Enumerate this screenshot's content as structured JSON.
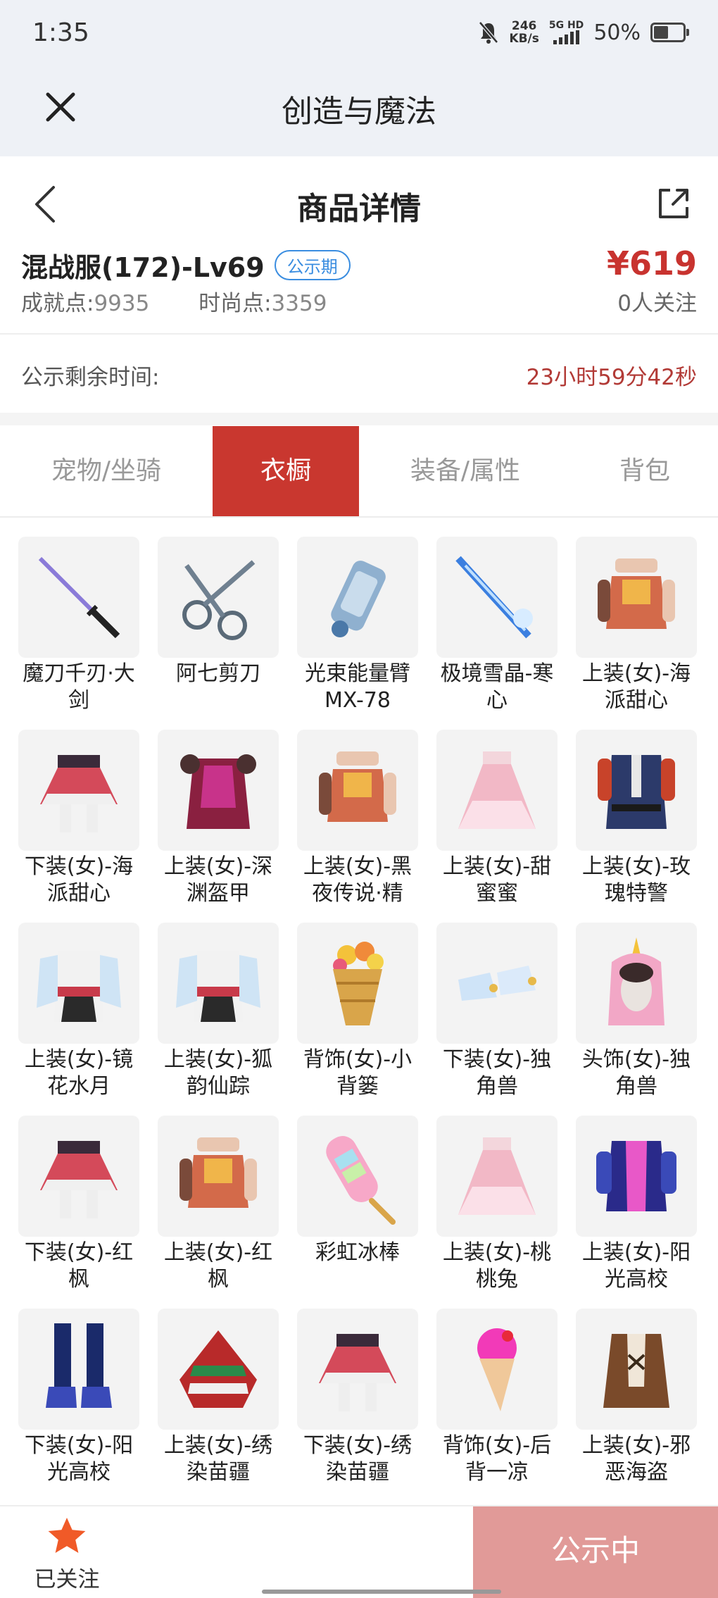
{
  "status_bar": {
    "time": "1:35",
    "speed_value": "246",
    "speed_unit": "KB/s",
    "network": "5G HD",
    "battery": "50%",
    "battery_level": 0.5
  },
  "app_bar": {
    "title": "创造与魔法"
  },
  "nav": {
    "title": "商品详情"
  },
  "item": {
    "name": "混战服(172)-Lv69",
    "badge": "公示期",
    "achievement_label": "成就点:",
    "achievement_value": "9935",
    "fashion_label": "时尚点:",
    "fashion_value": "3359",
    "price": "¥619",
    "followers": "0人关注"
  },
  "countdown": {
    "label": "公示剩余时间:",
    "value": "23小时59分42秒"
  },
  "tabs": [
    {
      "label": "宠物/坐骑",
      "active": false
    },
    {
      "label": "衣橱",
      "active": true
    },
    {
      "label": "装备/属性",
      "active": false
    },
    {
      "label": "背包",
      "active": false
    }
  ],
  "wardrobe": [
    {
      "label": "魔刀千刃·大剑",
      "icon": "sword-icon"
    },
    {
      "label": "阿七剪刀",
      "icon": "scissors-icon"
    },
    {
      "label": "光束能量臂MX-78",
      "icon": "arm-cannon-icon"
    },
    {
      "label": "极境雪晶-寒心",
      "icon": "ice-sword-icon"
    },
    {
      "label": "上装(女)-海派甜心",
      "icon": "top-outfit-icon"
    },
    {
      "label": "下装(女)-海派甜心",
      "icon": "skirt-icon"
    },
    {
      "label": "上装(女)-深渊盔甲",
      "icon": "armor-icon"
    },
    {
      "label": "上装(女)-黑夜传说·精",
      "icon": "top-outfit-icon"
    },
    {
      "label": "上装(女)-甜蜜蜜",
      "icon": "dress-icon"
    },
    {
      "label": "上装(女)-玫瑰特警",
      "icon": "uniform-icon"
    },
    {
      "label": "上装(女)-镜花水月",
      "icon": "kimono-icon"
    },
    {
      "label": "上装(女)-狐韵仙踪",
      "icon": "kimono-icon"
    },
    {
      "label": "背饰(女)-小背篓",
      "icon": "basket-icon"
    },
    {
      "label": "下装(女)-独角兽",
      "icon": "shoes-icon"
    },
    {
      "label": "头饰(女)-独角兽",
      "icon": "unicorn-hood-icon"
    },
    {
      "label": "下装(女)-红枫",
      "icon": "skirt-icon"
    },
    {
      "label": "上装(女)-红枫",
      "icon": "top-outfit-icon"
    },
    {
      "label": "彩虹冰棒",
      "icon": "popsicle-icon"
    },
    {
      "label": "上装(女)-桃桃兔",
      "icon": "dress-icon"
    },
    {
      "label": "上装(女)-阳光高校",
      "icon": "jacket-icon"
    },
    {
      "label": "下装(女)-阳光高校",
      "icon": "boots-icon"
    },
    {
      "label": "上装(女)-绣染苗疆",
      "icon": "poncho-icon"
    },
    {
      "label": "下装(女)-绣染苗疆",
      "icon": "skirt-icon"
    },
    {
      "label": "背饰(女)-后背一凉",
      "icon": "ice-cream-icon"
    },
    {
      "label": "上装(女)-邪恶海盗",
      "icon": "pirate-coat-icon"
    }
  ],
  "bottom": {
    "fav_label": "已关注",
    "cta_label": "公示中"
  },
  "colors": {
    "accent_red": "#c9372f",
    "price_red": "#c8332f",
    "cta_pink": "#e19a98",
    "badge_blue": "#3a8de0"
  }
}
